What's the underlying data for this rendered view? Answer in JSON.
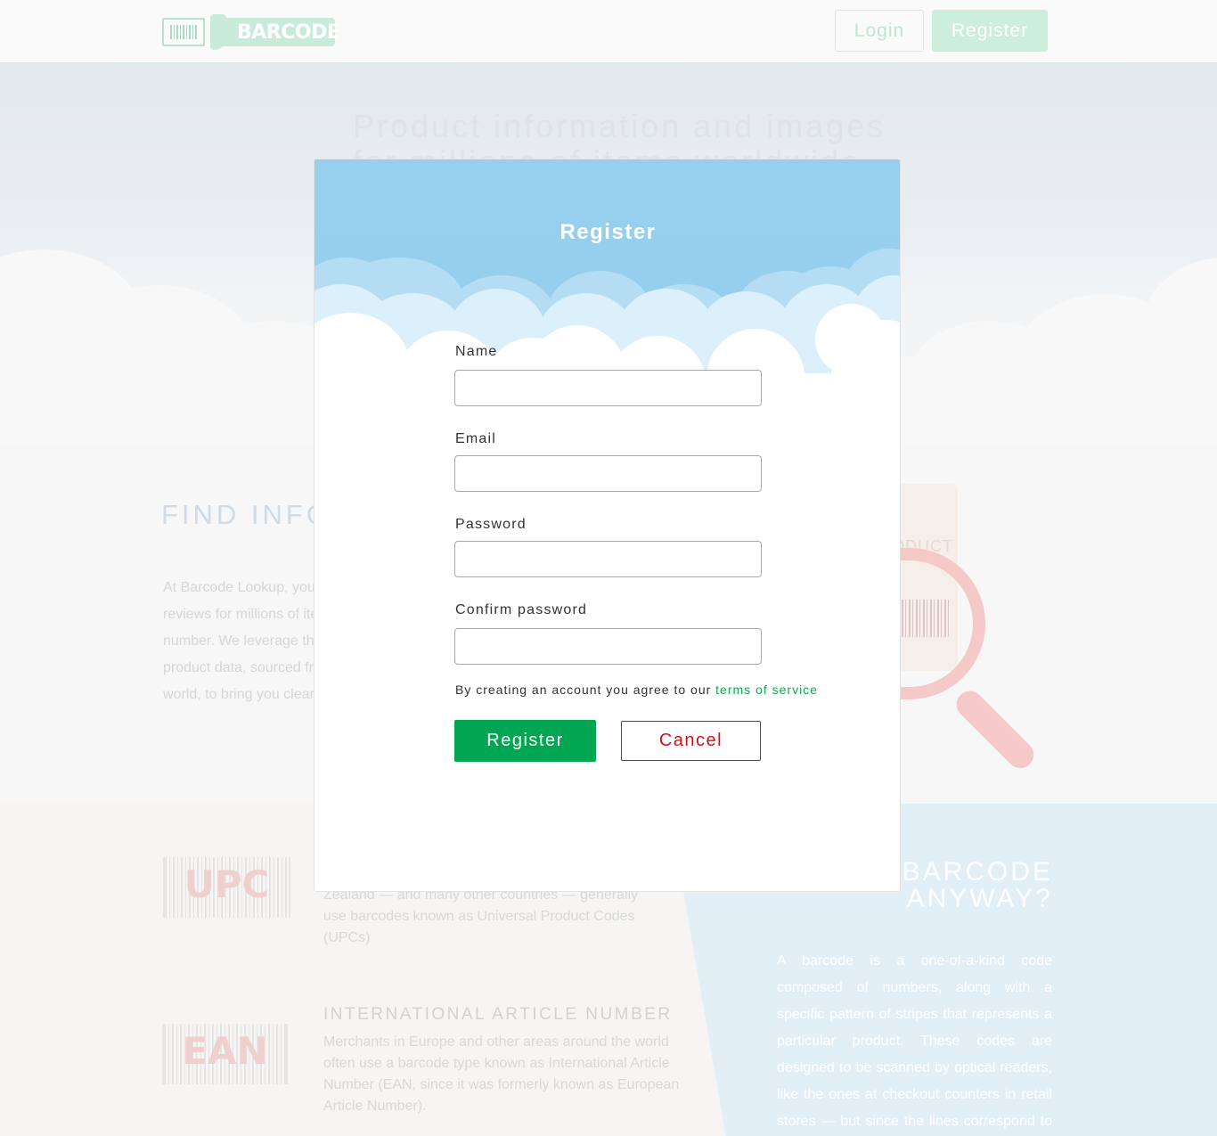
{
  "header": {
    "logo_text": "BARCODE",
    "login_label": "Login",
    "register_label": "Register"
  },
  "hero": {
    "title": "Product information and images for millions of items worldwide"
  },
  "find_section": {
    "title": "FIND INFO",
    "text_lines": [
      "At Barcode Lookup, you",
      "reviews for millions of ite",
      "number. We leverage the",
      "product data, sourced fr",
      "world, to bring you clear"
    ],
    "tag_word": "PRODUCT"
  },
  "upc": {
    "badge": "UPC",
    "description": "Zealand — and many other countries — generally use barcodes known as Universal Product Codes (UPCs)"
  },
  "ean": {
    "badge": "EAN",
    "title": "INTERNATIONAL ARTICLE NUMBER",
    "description": "Merchants in Europe and other areas around the world often use a barcode type known as International Article Number (EAN, since it was formerly known as European Article Number)."
  },
  "why": {
    "title_line1": "BARCODE",
    "title_line2": "ANYWAY?",
    "text": "A barcode is a one-of-a-kind code composed of numbers, along with a specific pattern of stripes that represents a particular product. These codes are designed to be scanned by optical readers, like the ones at checkout counters in retail stores — but since the lines correspond to a list of num-"
  },
  "modal": {
    "title": "Register",
    "fields": {
      "name": {
        "label": "Name",
        "value": ""
      },
      "email": {
        "label": "Email",
        "value": ""
      },
      "password": {
        "label": "Password",
        "value": ""
      },
      "confirm": {
        "label": "Confirm password",
        "value": ""
      }
    },
    "agree_text": "By creating an account you agree to our ",
    "agree_link": "terms of service",
    "register_label": "Register",
    "cancel_label": "Cancel"
  },
  "colors": {
    "accent_green": "#00a651",
    "cancel_red": "#d0111b",
    "sky_blue": "#97cfee"
  }
}
